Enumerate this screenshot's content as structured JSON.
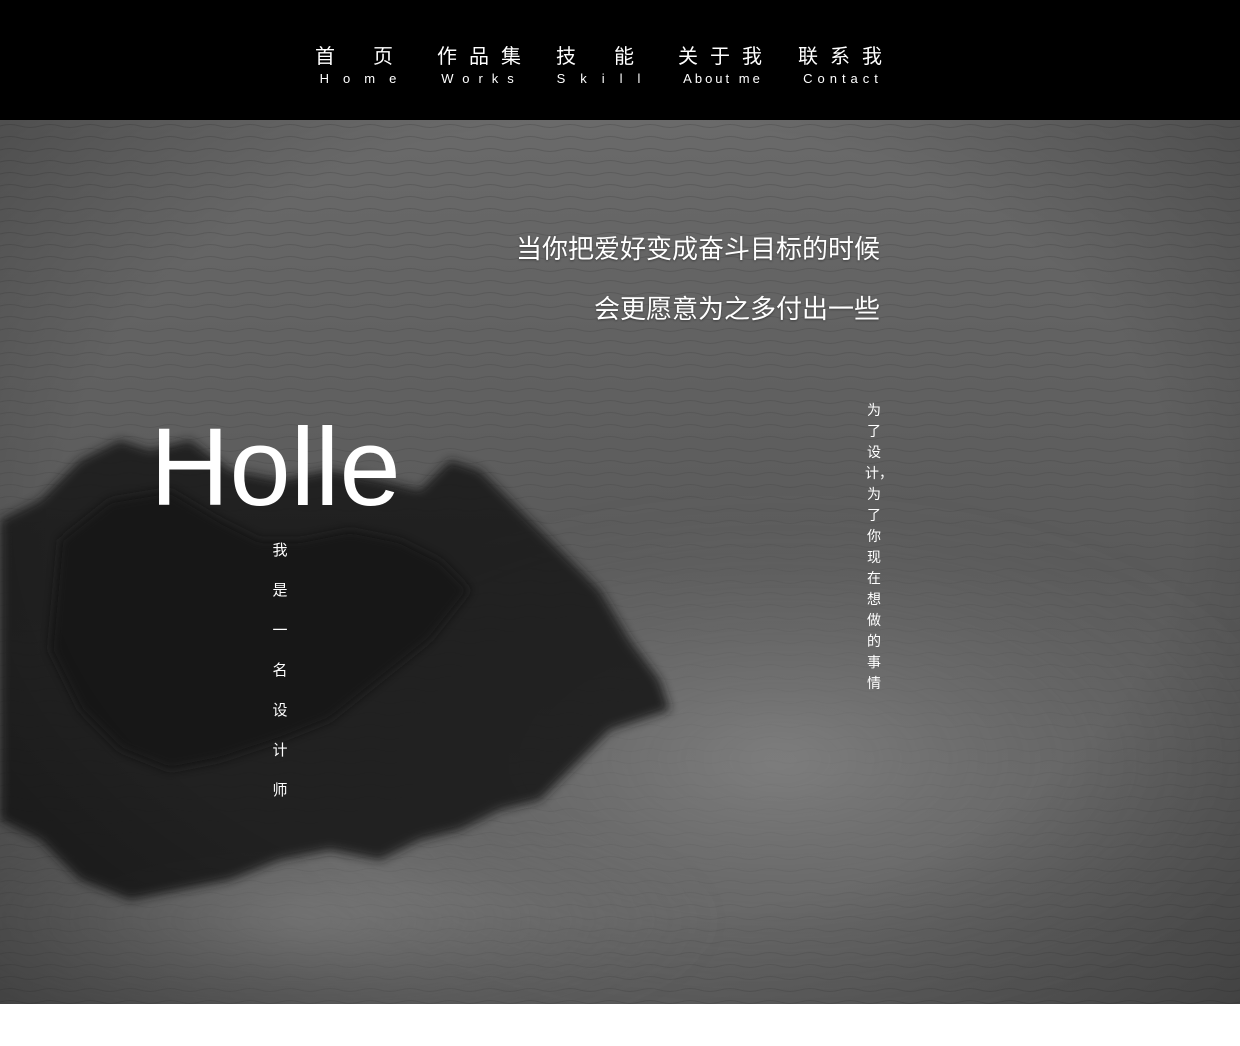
{
  "nav": {
    "items": [
      {
        "zh": "首页",
        "en": "Home"
      },
      {
        "zh": "作品集",
        "en": "Works"
      },
      {
        "zh": "技能",
        "en": "Skill"
      },
      {
        "zh": "关于我",
        "en": "About me"
      },
      {
        "zh": "联系我",
        "en": "Contact"
      }
    ]
  },
  "hero": {
    "quote_line_1": "当你把爱好变成奋斗目标的时候",
    "quote_line_2": "会更愿意为之多付出一些",
    "greeting": "Holle",
    "intro_vertical": "我是一名设计师",
    "motto_vertical": "为了设计，为了你现在想做的事情"
  },
  "colors": {
    "nav_background": "#000000",
    "text": "#ffffff",
    "hero_tone": "#5c5c5c"
  }
}
